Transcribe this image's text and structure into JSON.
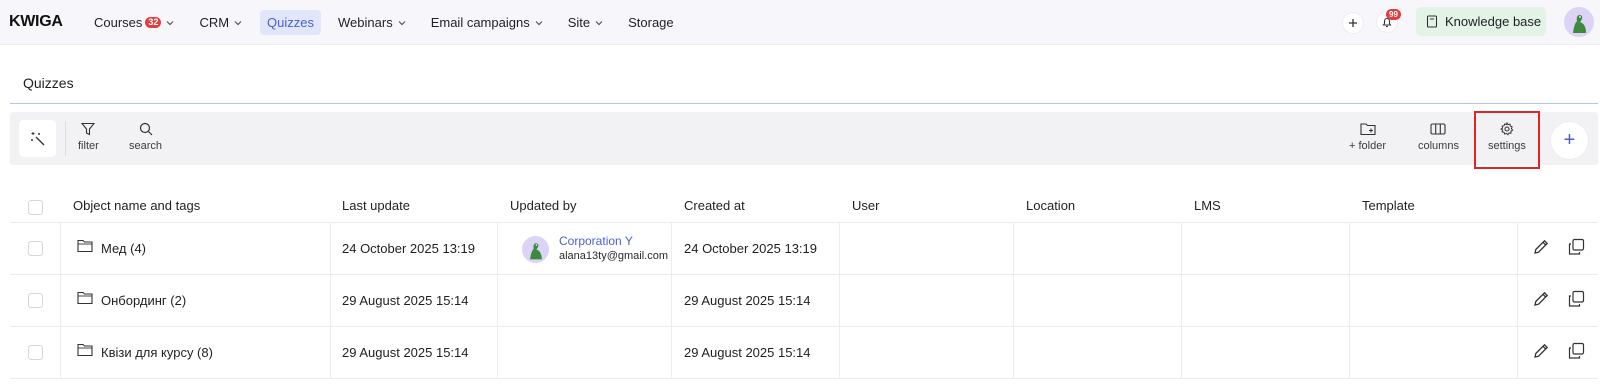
{
  "app": {
    "logo": "KWIGA"
  },
  "nav": [
    {
      "label": "Courses",
      "badge": "32",
      "has_chevron": true,
      "active": false
    },
    {
      "label": "CRM",
      "has_chevron": true,
      "active": false
    },
    {
      "label": "Quizzes",
      "has_chevron": false,
      "active": true
    },
    {
      "label": "Webinars",
      "has_chevron": true,
      "active": false
    },
    {
      "label": "Email campaigns",
      "has_chevron": true,
      "active": false
    },
    {
      "label": "Site",
      "has_chevron": true,
      "active": false
    },
    {
      "label": "Storage",
      "has_chevron": false,
      "active": false
    }
  ],
  "header_right": {
    "notifications_badge": "99",
    "knowledge_base_label": "Knowledge base"
  },
  "page": {
    "title": "Quizzes"
  },
  "toolbar": {
    "filter_label": "filter",
    "search_label": "search",
    "folder_label": "+ folder",
    "columns_label": "columns",
    "settings_label": "settings",
    "add_symbol": "+"
  },
  "table": {
    "columns": [
      "Object name and tags",
      "Last update",
      "Updated by",
      "Created at",
      "User",
      "Location",
      "LMS",
      "Template"
    ],
    "rows": [
      {
        "name": "Мед (4)",
        "last_update": "24 October 2025 13:19",
        "updated_by": {
          "name": "Corporation Y",
          "email": "alana13ty@gmail.com"
        },
        "created_at": "24 October 2025 13:19",
        "user": "",
        "location": "",
        "lms": "",
        "template": ""
      },
      {
        "name": "Онбординг (2)",
        "last_update": "29 August 2025 15:14",
        "updated_by": null,
        "created_at": "29 August 2025 15:14",
        "user": "",
        "location": "",
        "lms": "",
        "template": ""
      },
      {
        "name": "Квізи для курсу (8)",
        "last_update": "29 August 2025 15:14",
        "updated_by": null,
        "created_at": "29 August 2025 15:14",
        "user": "",
        "location": "",
        "lms": "",
        "template": ""
      }
    ]
  },
  "colors": {
    "accent": "#4a5fd6",
    "active_nav_bg": "#e2e6fb",
    "badge_red": "#e23d3d",
    "knowledge_base_bg": "#e3f3e5",
    "highlight_box": "#e02525"
  },
  "icons": [
    "chevron-down-icon",
    "plus-icon",
    "bell-icon",
    "book-icon",
    "magic-wand-icon",
    "filter-icon",
    "search-icon",
    "folder-plus-icon",
    "columns-icon",
    "settings-icon",
    "folder-icon",
    "edit-icon",
    "copy-icon"
  ]
}
